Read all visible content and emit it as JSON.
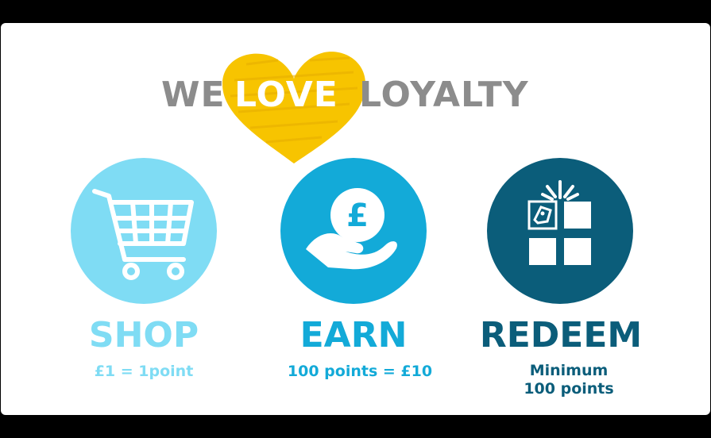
{
  "title": {
    "word_we": "WE",
    "word_love": "LOVE",
    "word_loyalty": "LOYALTY"
  },
  "steps": [
    {
      "label": "SHOP",
      "caption": "£1 = 1point",
      "icon": "shopping-cart-icon",
      "color": "#7fdcf4"
    },
    {
      "label": "EARN",
      "caption": "100 points = £10",
      "icon": "hand-coin-pound-icon",
      "color": "#13aad8"
    },
    {
      "label": "REDEEM",
      "caption_line1": "Minimum",
      "caption_line2": "100 points",
      "icon": "gift-box-icon",
      "color": "#0b5d7a"
    }
  ],
  "colors": {
    "heart": "#f7c400",
    "title_grey": "#8c8c8c",
    "background": "#ffffff"
  }
}
